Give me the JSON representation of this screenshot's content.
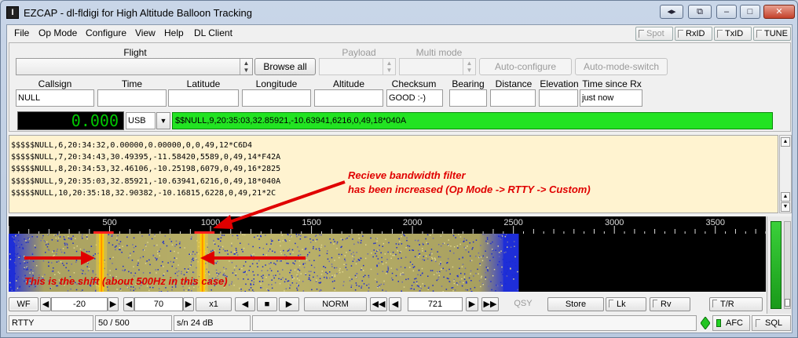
{
  "window": {
    "title": "EZCAP - dl-fldigi for High Altitude Balloon Tracking",
    "app_icon_glyph": "I"
  },
  "caption_buttons": {
    "back": "◂▸",
    "pin": "⧉",
    "minimize": "–",
    "maximize": "□",
    "close": "✕"
  },
  "menu": [
    "File",
    "Op Mode",
    "Configure",
    "View",
    "Help",
    "DL Client"
  ],
  "toolbar": {
    "spot": "Spot",
    "rxid": "RxID",
    "txid": "TxID",
    "tune": "TUNE"
  },
  "top_panel": {
    "flight_label": "Flight",
    "flight_value": "",
    "browse_all": "Browse all",
    "payload_label": "Payload",
    "multimode_label": "Multi mode",
    "auto_configure": "Auto-configure",
    "auto_mode_switch": "Auto-mode-switch",
    "headers": {
      "callsign": "Callsign",
      "time": "Time",
      "latitude": "Latitude",
      "longitude": "Longitude",
      "altitude": "Altitude",
      "checksum": "Checksum",
      "bearing": "Bearing",
      "distance": "Distance",
      "elevation": "Elevation",
      "time_since_rx": "Time since Rx"
    },
    "values": {
      "callsign": "NULL",
      "time": "",
      "latitude": "",
      "longitude": "",
      "altitude": "",
      "checksum": "GOOD :-)",
      "bearing": "",
      "distance": "",
      "elevation": "",
      "time_since_rx": "just now"
    },
    "frequency": "0.000",
    "mode": "USB",
    "last_sentence": "$$NULL,9,20:35:03,32.85921,-10.63941,6216,0,49,18*040A"
  },
  "rx_lines": [
    "$$$$$NULL,6,20:34:32,0.00000,0.00000,0,0,49,12*C6D4",
    "$$$$$NULL,7,20:34:43,30.49395,-11.58420,5589,0,49,14*F42A",
    "$$$$$NULL,8,20:34:53,32.46106,-10.25198,6079,0,49,16*2825",
    "$$$$$NULL,9,20:35:03,32.85921,-10.63941,6216,0,49,18*040A",
    "$$$$$NULL,10,20:35:18,32.90382,-10.16815,6228,0,49,21*2C"
  ],
  "annotations": {
    "filter_line1": "Recieve bandwidth filter",
    "filter_line2": "has been increased (Op Mode -> RTTY -> Custom)",
    "shift": "This is the shift (about 500Hz in this case)"
  },
  "chart_data": {
    "type": "heatmap",
    "x_ticks": [
      500,
      1000,
      1500,
      2000,
      2500,
      3000,
      3500
    ],
    "xlim": [
      0,
      3750
    ],
    "signal_band": [
      0,
      2480
    ],
    "carrier_markers": [
      460,
      960
    ],
    "bandwidth_markers": [
      [
        420,
        520
      ],
      [
        920,
        1020
      ]
    ],
    "colors": {
      "noise": "#1e2ed8",
      "signal": "#b8b060",
      "carrier": "#ffd000",
      "marker": "#ff2020"
    }
  },
  "controls": {
    "wf": "WF",
    "level": "-20",
    "range": "70",
    "zoom": "x1",
    "norm": "NORM",
    "freq": "721",
    "qsy": "QSY",
    "store": "Store",
    "lk": "Lk",
    "rv": "Rv",
    "tr": "T/R"
  },
  "status": {
    "mode": "RTTY",
    "width": "50  / 500",
    "sn": "s/n  24 dB",
    "message": "",
    "afc": "AFC",
    "sql": "SQL"
  }
}
